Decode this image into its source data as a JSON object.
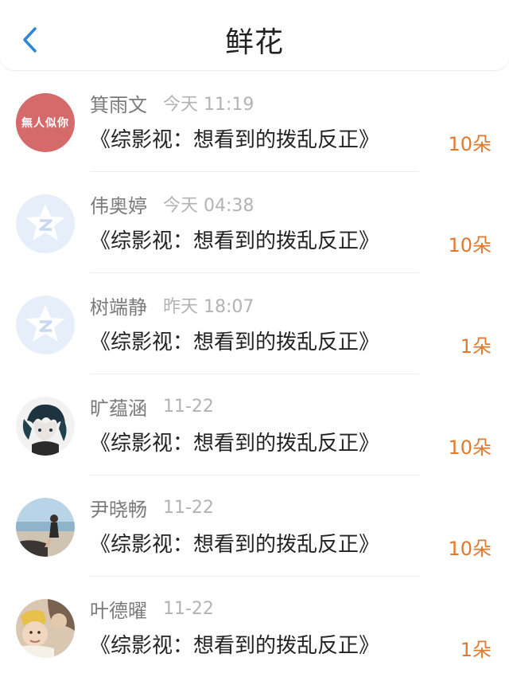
{
  "header": {
    "title": "鲜花",
    "back_icon": "chevron-left-icon",
    "accent": "#2f86d6"
  },
  "items": [
    {
      "name": "箕雨文",
      "time": "今天 11:19",
      "work": "《综影视：想看到的拨乱反正》",
      "count": "10朵",
      "avatar": {
        "type": "text",
        "text": "無人似你",
        "bg": "#d46a6a"
      }
    },
    {
      "name": "伟奥婷",
      "time": "今天 04:38",
      "work": "《综影视：想看到的拨乱反正》",
      "count": "10朵",
      "avatar": {
        "type": "qq-icon"
      }
    },
    {
      "name": "树端静",
      "time": "昨天 18:07",
      "work": "《综影视：想看到的拨乱反正》",
      "count": "1朵",
      "avatar": {
        "type": "qq-icon"
      }
    },
    {
      "name": "旷蕴涵",
      "time": "11-22",
      "work": "《综影视：想看到的拨乱反正》",
      "count": "10朵",
      "avatar": {
        "type": "photo",
        "icon": "anime-character-photo"
      }
    },
    {
      "name": "尹晓畅",
      "time": "11-22",
      "work": "《综影视：想看到的拨乱反正》",
      "count": "10朵",
      "avatar": {
        "type": "photo",
        "icon": "seaside-person-photo"
      }
    },
    {
      "name": "叶德曜",
      "time": "11-22",
      "work": "《综影视：想看到的拨乱反正》",
      "count": "1朵",
      "avatar": {
        "type": "photo",
        "icon": "family-baby-photo"
      }
    }
  ],
  "colors": {
    "count": "#e07a2f",
    "name": "#7a7a7a",
    "time": "#b3b3b3"
  }
}
